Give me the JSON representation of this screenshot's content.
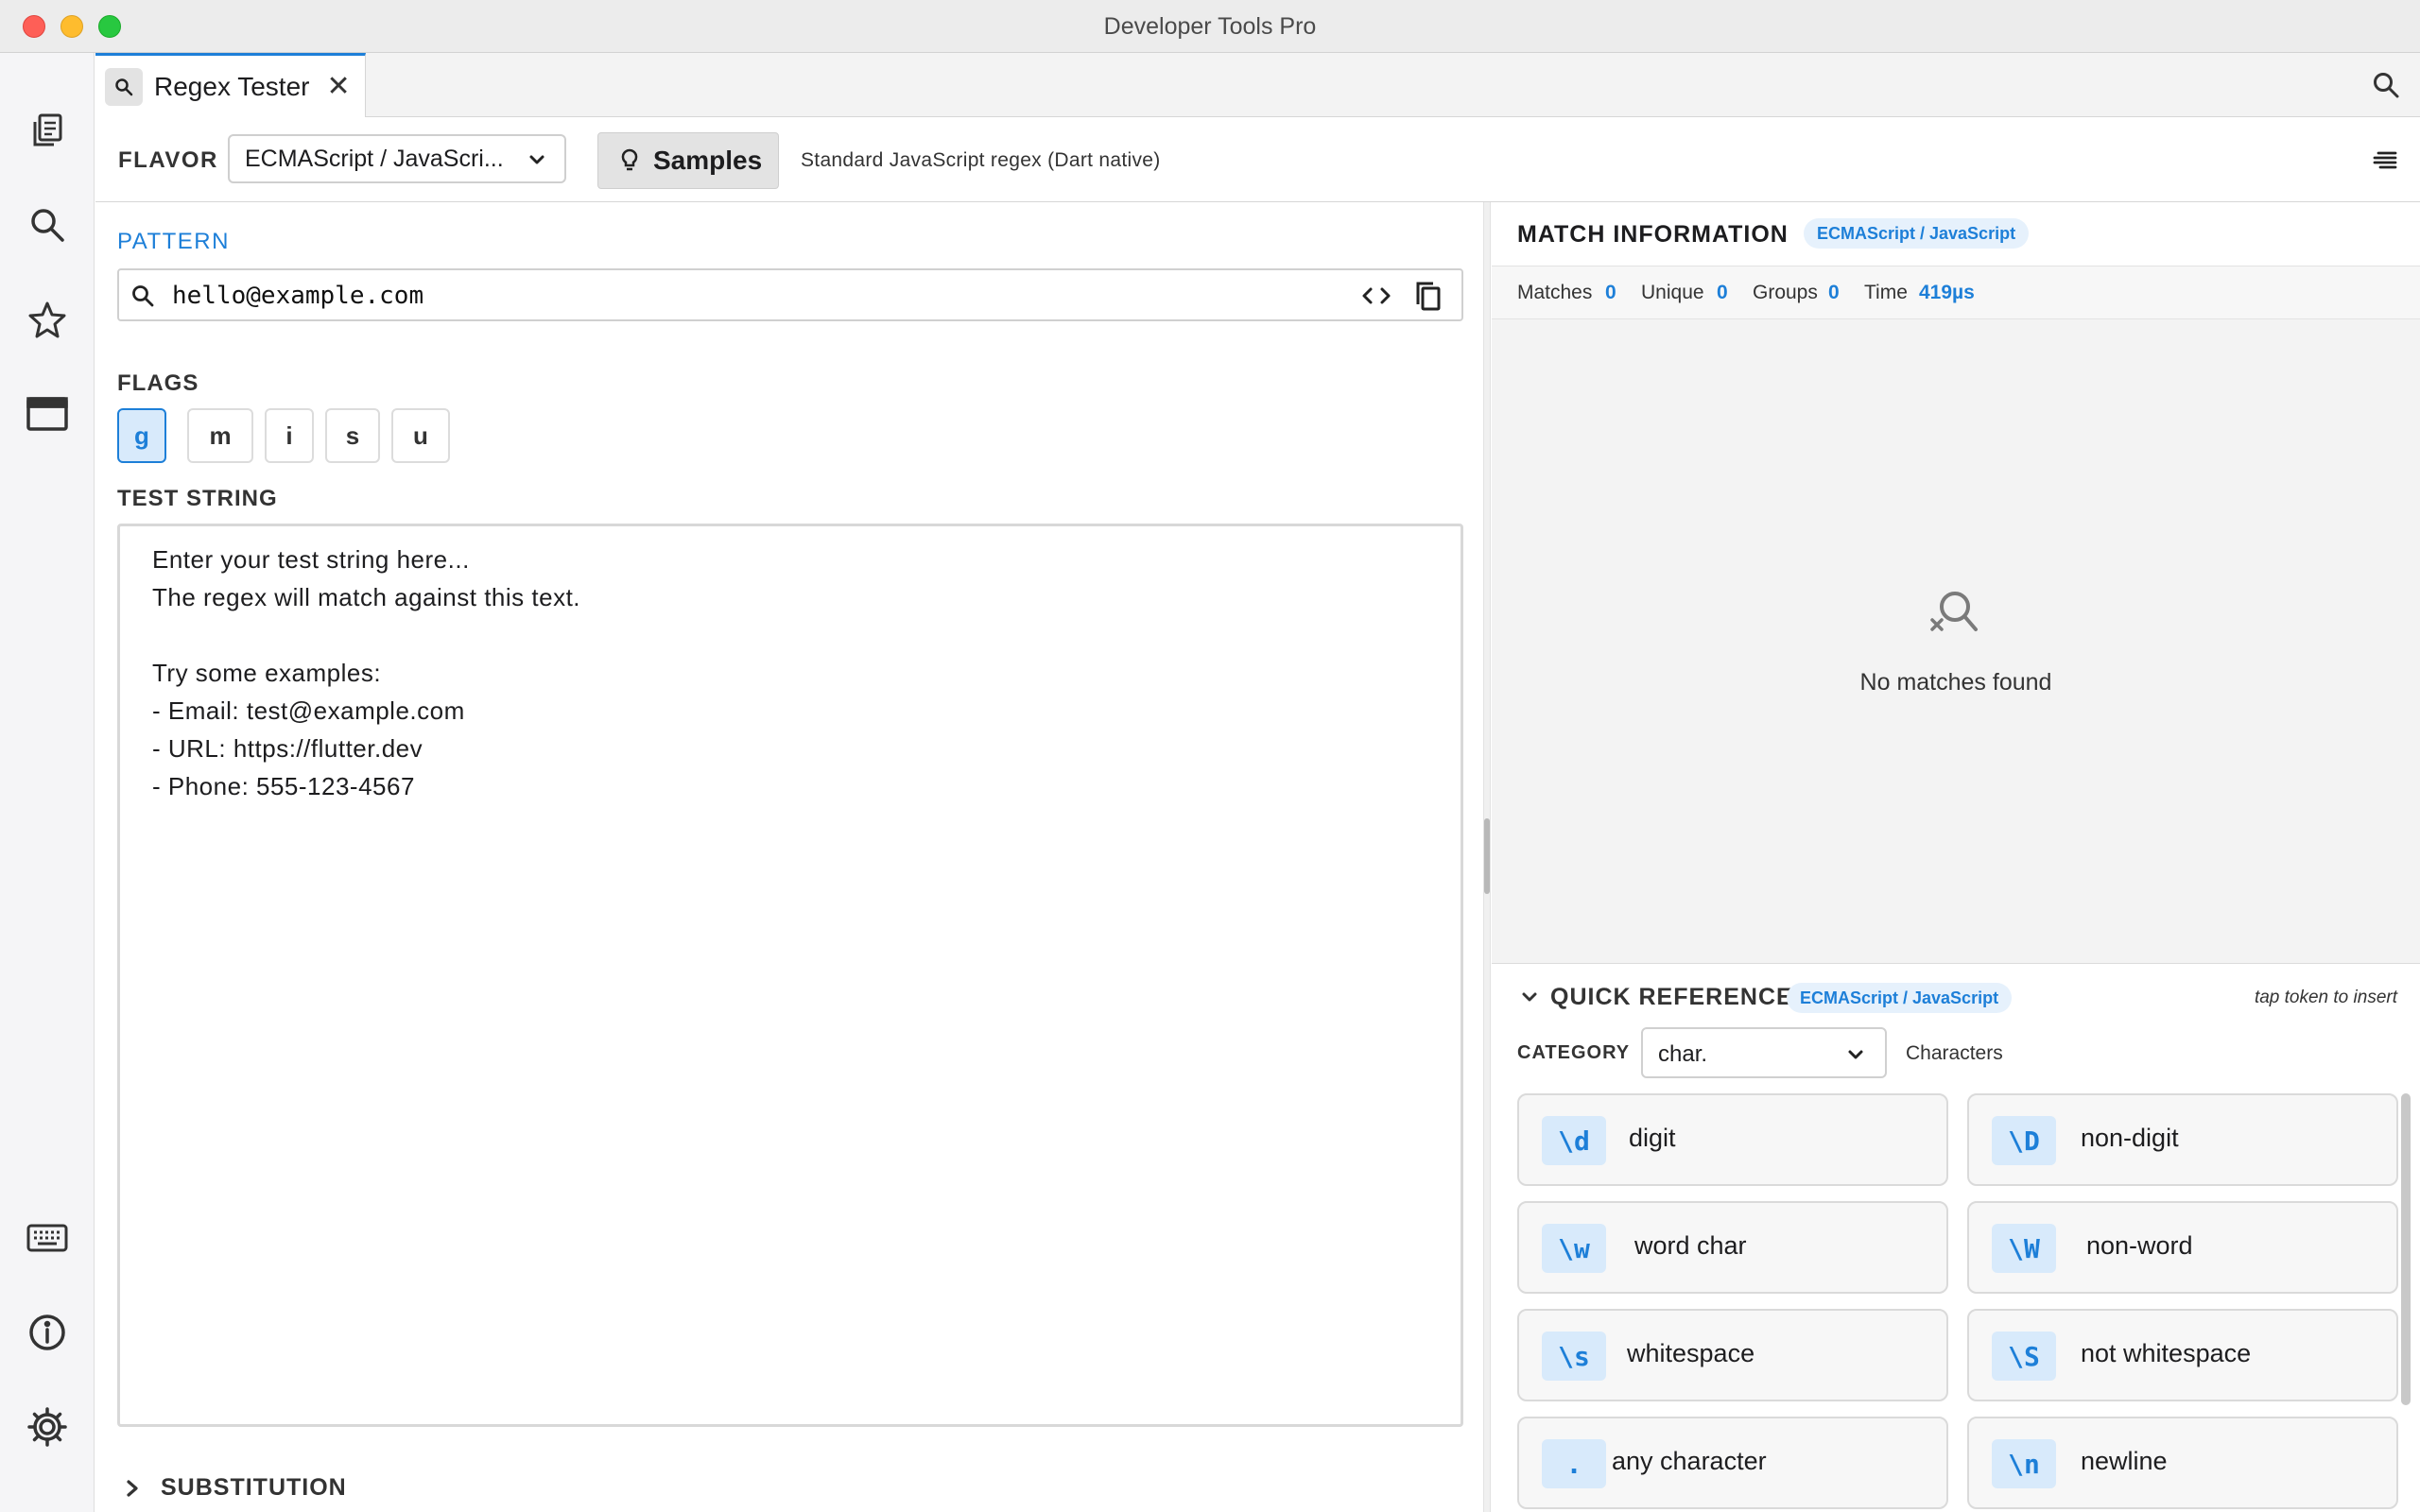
{
  "window": {
    "title": "Developer Tools Pro"
  },
  "sidebar": {
    "items": [
      {
        "icon": "documents-icon"
      },
      {
        "icon": "search-icon"
      },
      {
        "icon": "star-icon"
      },
      {
        "icon": "window-icon"
      },
      {
        "icon": "keyboard-icon"
      },
      {
        "icon": "info-icon"
      },
      {
        "icon": "gear-icon"
      }
    ]
  },
  "tabs": [
    {
      "label": "Regex Tester",
      "icon": "search-icon",
      "close": "✕"
    }
  ],
  "toolbar": {
    "flavor_label": "FLAVOR",
    "flavor_value": "ECMAScript / JavaScri...",
    "samples_label": "Samples",
    "flavor_description": "Standard JavaScript regex (Dart native)"
  },
  "pattern": {
    "label": "PATTERN",
    "value": "hello@example.com"
  },
  "flags": {
    "label": "FLAGS",
    "items": [
      {
        "label": "g",
        "active": true
      },
      {
        "label": "m",
        "active": false
      },
      {
        "label": "i",
        "active": false
      },
      {
        "label": "s",
        "active": false
      },
      {
        "label": "u",
        "active": false
      }
    ]
  },
  "test_string": {
    "label": "TEST STRING",
    "lines": [
      "Enter your test string here...",
      "The regex will match against this text.",
      "",
      "Try some examples:",
      "- Email: test@example.com",
      "- URL: https://flutter.dev",
      "- Phone: 555-123-4567"
    ]
  },
  "substitution": {
    "label": "SUBSTITUTION"
  },
  "match_info": {
    "title": "MATCH INFORMATION",
    "flavor_chip": "ECMAScript / JavaScript",
    "stats": [
      {
        "key": "Matches",
        "value": "0"
      },
      {
        "key": "Unique",
        "value": "0"
      },
      {
        "key": "Groups",
        "value": "0"
      },
      {
        "key": "Time",
        "value": "419µs"
      }
    ],
    "empty_message": "No matches found"
  },
  "quick_reference": {
    "title": "QUICK REFERENCE",
    "flavor_chip": "ECMAScript / JavaScript",
    "hint": "tap token to insert",
    "category_label": "CATEGORY",
    "category_value": "char.",
    "category_description": "Characters",
    "items": [
      {
        "token": "\\d",
        "desc": "digit"
      },
      {
        "token": "\\D",
        "desc": "non-digit"
      },
      {
        "token": "\\w",
        "desc": "word char"
      },
      {
        "token": "\\W",
        "desc": "non-word"
      },
      {
        "token": "\\s",
        "desc": "whitespace"
      },
      {
        "token": "\\S",
        "desc": "not whitespace"
      },
      {
        "token": ".",
        "desc": "any character"
      },
      {
        "token": "\\n",
        "desc": "newline"
      }
    ]
  },
  "colors": {
    "accent": "#1d7fd8",
    "accent_bg": "#d8eafb",
    "close": "#fe5f57",
    "minimize": "#febc2e",
    "zoom": "#28c840"
  }
}
